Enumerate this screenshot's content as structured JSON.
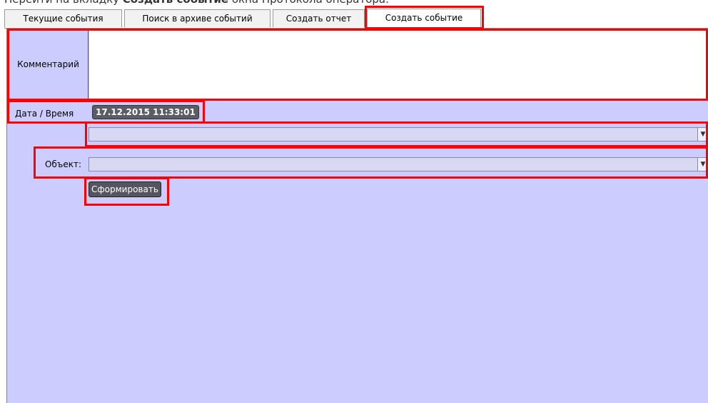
{
  "caption": {
    "prefix": "Перейти на вкладку ",
    "bold": "Создать событие",
    "suffix": " окна Протокола оператора."
  },
  "tabs": [
    {
      "label": "Текущие события",
      "active": false
    },
    {
      "label": "Поиск в архиве событий",
      "active": false
    },
    {
      "label": "Создать отчет",
      "active": false
    },
    {
      "label": "Создать событие",
      "active": true
    }
  ],
  "form": {
    "comment_label": "Комментарий",
    "comment_value": "",
    "datetime_label": "Дата / Время",
    "datetime_value": "17.12.2015 11:33:01",
    "event_type_value": "",
    "object_label": "Объект:",
    "object_value": "",
    "submit_label": "Сформировать"
  },
  "colors": {
    "panel_bg": "#ccccff",
    "highlight": "#ff0000"
  },
  "icons": {
    "dropdown": "chevron-down-icon"
  }
}
